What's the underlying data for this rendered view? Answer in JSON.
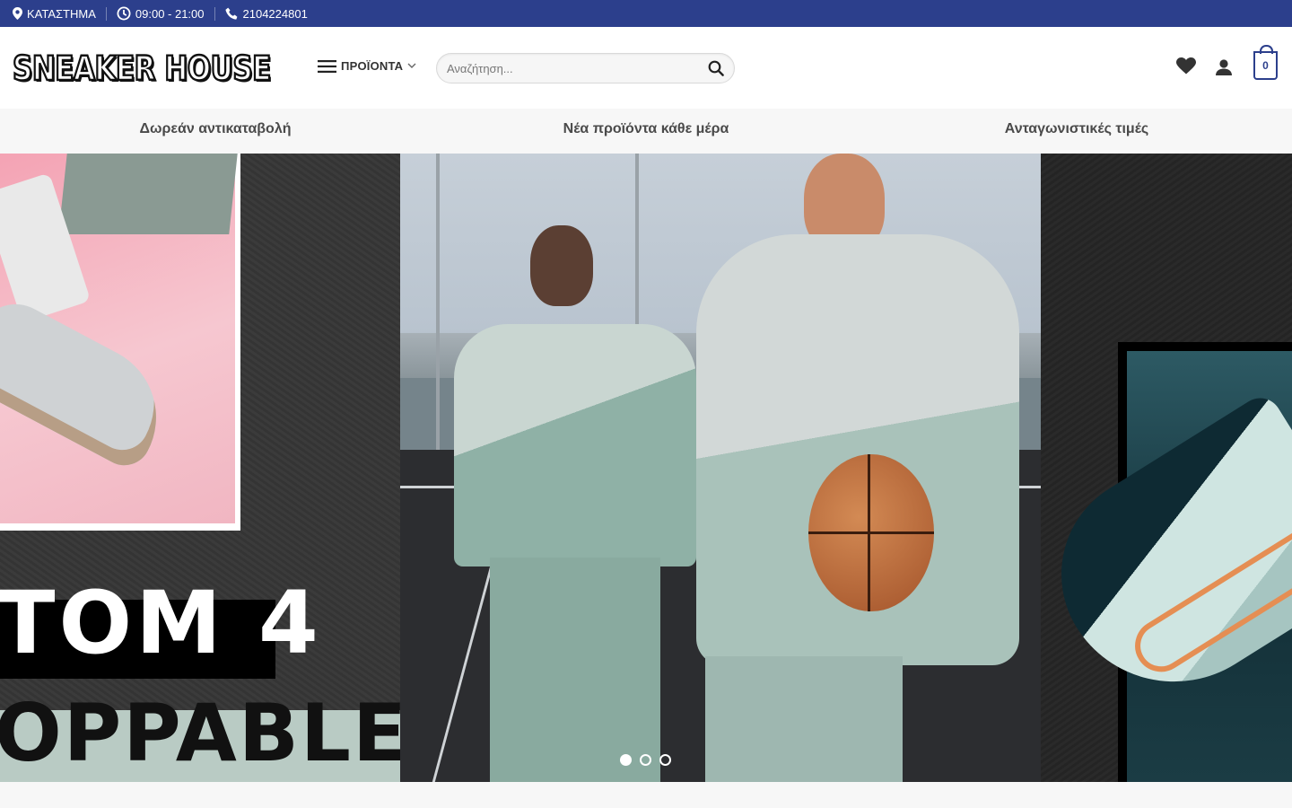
{
  "topbar": {
    "store_label": "ΚΑΤΑΣΤΗΜΑ",
    "hours": "09:00 - 21:00",
    "phone": "2104224801",
    "bg_color": "#2c3f8c"
  },
  "header": {
    "logo_text": "SNEAKER HOUSE",
    "menu_label": "ΠΡΟΪΟΝΤΑ",
    "search_placeholder": "Αναζήτηση...",
    "cart_count": "0",
    "icons": [
      "heart-icon",
      "user-icon",
      "cart-icon"
    ]
  },
  "features": [
    "Δωρεάν αντικαταβολή",
    "Νέα προϊόντα κάθε μέρα",
    "Ανταγωνιστικές τιμές"
  ],
  "hero": {
    "text_line_1": "TOM 4",
    "text_line_2": "OPPABLE",
    "slides_total": 3,
    "active_slide": 1
  }
}
